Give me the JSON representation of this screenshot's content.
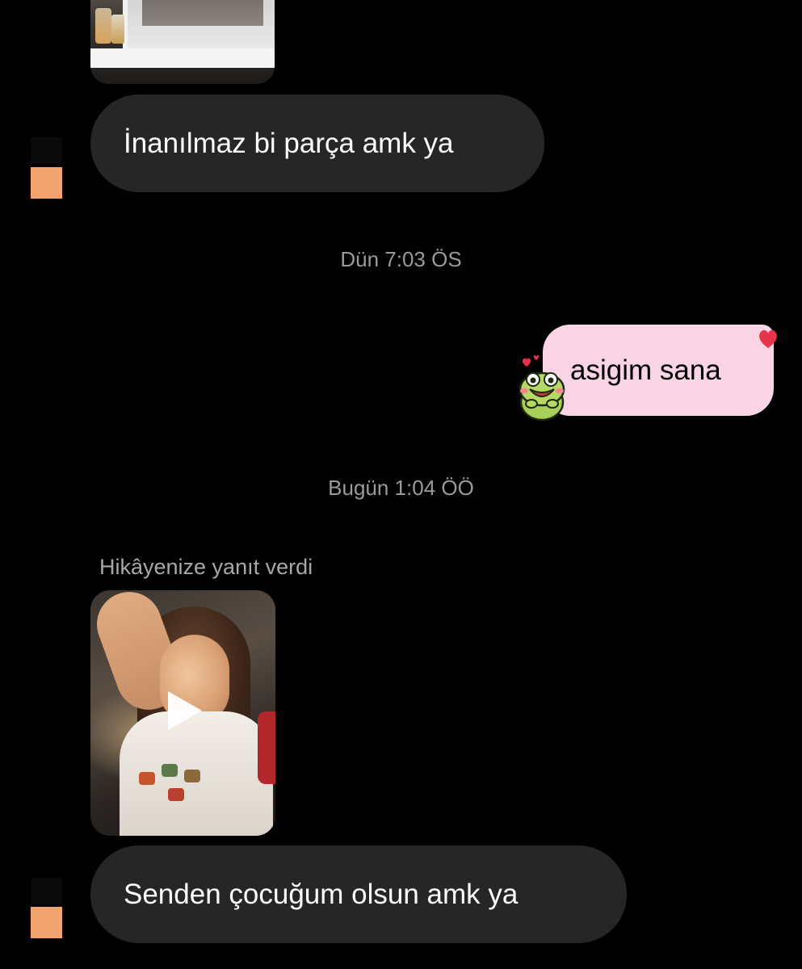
{
  "messages": [
    {
      "id": "m1",
      "direction": "incoming",
      "text": "İnanılmaz bi parça amk ya"
    },
    {
      "id": "m2",
      "direction": "outgoing",
      "text": "asigim sana",
      "reaction_icon": "heart-icon",
      "sticker_icon": "frog-sticker-icon"
    },
    {
      "id": "m3",
      "direction": "incoming",
      "reply_label": "Hikâyenize yanıt verdi",
      "attachment": "story-video",
      "text": "Senden çocuğum olsun amk ya"
    }
  ],
  "timestamps": {
    "yesterday": "Dün 7:03 ÖS",
    "today": "Bugün 1:04 ÖÖ"
  },
  "colors": {
    "background": "#000000",
    "incoming_bubble": "#262626",
    "outgoing_bubble": "#f8d4e5",
    "avatar": "#f2a36f",
    "timestamp_text": "#9a9a9a",
    "reaction_heart": "#e8344a"
  },
  "icons": {
    "play": "play-icon",
    "reaction": "heart-icon",
    "sticker": "frog-sticker-icon"
  }
}
